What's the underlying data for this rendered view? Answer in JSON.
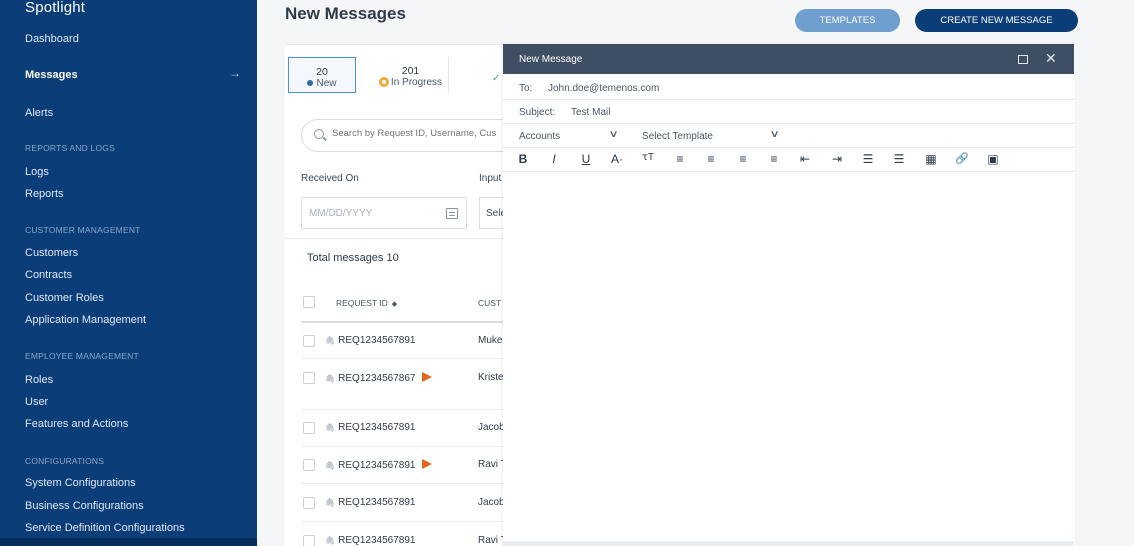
{
  "sidebar": {
    "brand": "Spotlight",
    "items": {
      "dashboard": "Dashboard",
      "messages": "Messages",
      "messages_arrow": "→",
      "alerts": "Alerts",
      "section_reports": "REPORTS AND LOGS",
      "logs": "Logs",
      "reports": "Reports",
      "section_customer": "CUSTOMER MANAGEMENT",
      "customers": "Customers",
      "contracts": "Contracts",
      "customer_roles": "Customer Roles",
      "application_management": "Application Management",
      "section_employee": "EMPLOYEE MANAGEMENT",
      "roles": "Roles",
      "user": "User",
      "features_actions": "Features and Actions",
      "section_config": "CONFIGURATIONS",
      "system_config": "System Configurations",
      "business_config": "Business Configurations",
      "service_def_config": "Service Definition Configurations"
    }
  },
  "header": {
    "title": "New Messages",
    "templates_button": "TEMPLATES",
    "create_button": "CREATE NEW MESSAGE"
  },
  "status": {
    "new_count": "20",
    "new_label": "New",
    "progress_count": "201",
    "progress_label": "In Progress",
    "partial_icon": "✓"
  },
  "search": {
    "placeholder": "Search by Request ID, Username, Cus"
  },
  "filters": {
    "received_on_label": "Received On",
    "date_placeholder": "MM/DD/YYYY",
    "input_label_partial": "Input",
    "select_partial": "Sele"
  },
  "table": {
    "total": "Total messages 10",
    "col_request_id": "REQUEST ID",
    "sort_icon": "◆",
    "col_customer_partial": "CUST",
    "rows": [
      {
        "id": "REQ1234567891",
        "customer": "Muke",
        "flag": false
      },
      {
        "id": "REQ1234567867",
        "customer": "Kriste",
        "flag": true
      },
      {
        "id": "REQ1234567891",
        "customer": "Jacob",
        "flag": false
      },
      {
        "id": "REQ1234567891",
        "customer": "Ravi T",
        "flag": true
      },
      {
        "id": "REQ1234567891",
        "customer": "Jacob",
        "flag": false
      },
      {
        "id": "REQ1234567891",
        "customer": "Ravi T",
        "flag": false
      }
    ]
  },
  "compose": {
    "title": "New Message",
    "to_label": "To:",
    "to_value": "John.doe@temenos.com",
    "subject_label": "Subject:",
    "subject_value": "Test Mail",
    "category_value": "Accounts",
    "template_value": "Select Template",
    "chevron": "∨",
    "close_glyph": "✕",
    "toolbar": [
      "B",
      "I",
      "U",
      "A·",
      "ꚍT",
      "≡",
      "≡",
      "≡",
      "≡",
      "⇤",
      "⇥",
      "☰",
      "☰",
      "▦",
      "🔗",
      "▣"
    ]
  },
  "colors": {
    "sidebar": "#0b3d78",
    "accent": "#6f9fcf",
    "modal_header": "#3e4f63",
    "flag": "#e0661c"
  }
}
